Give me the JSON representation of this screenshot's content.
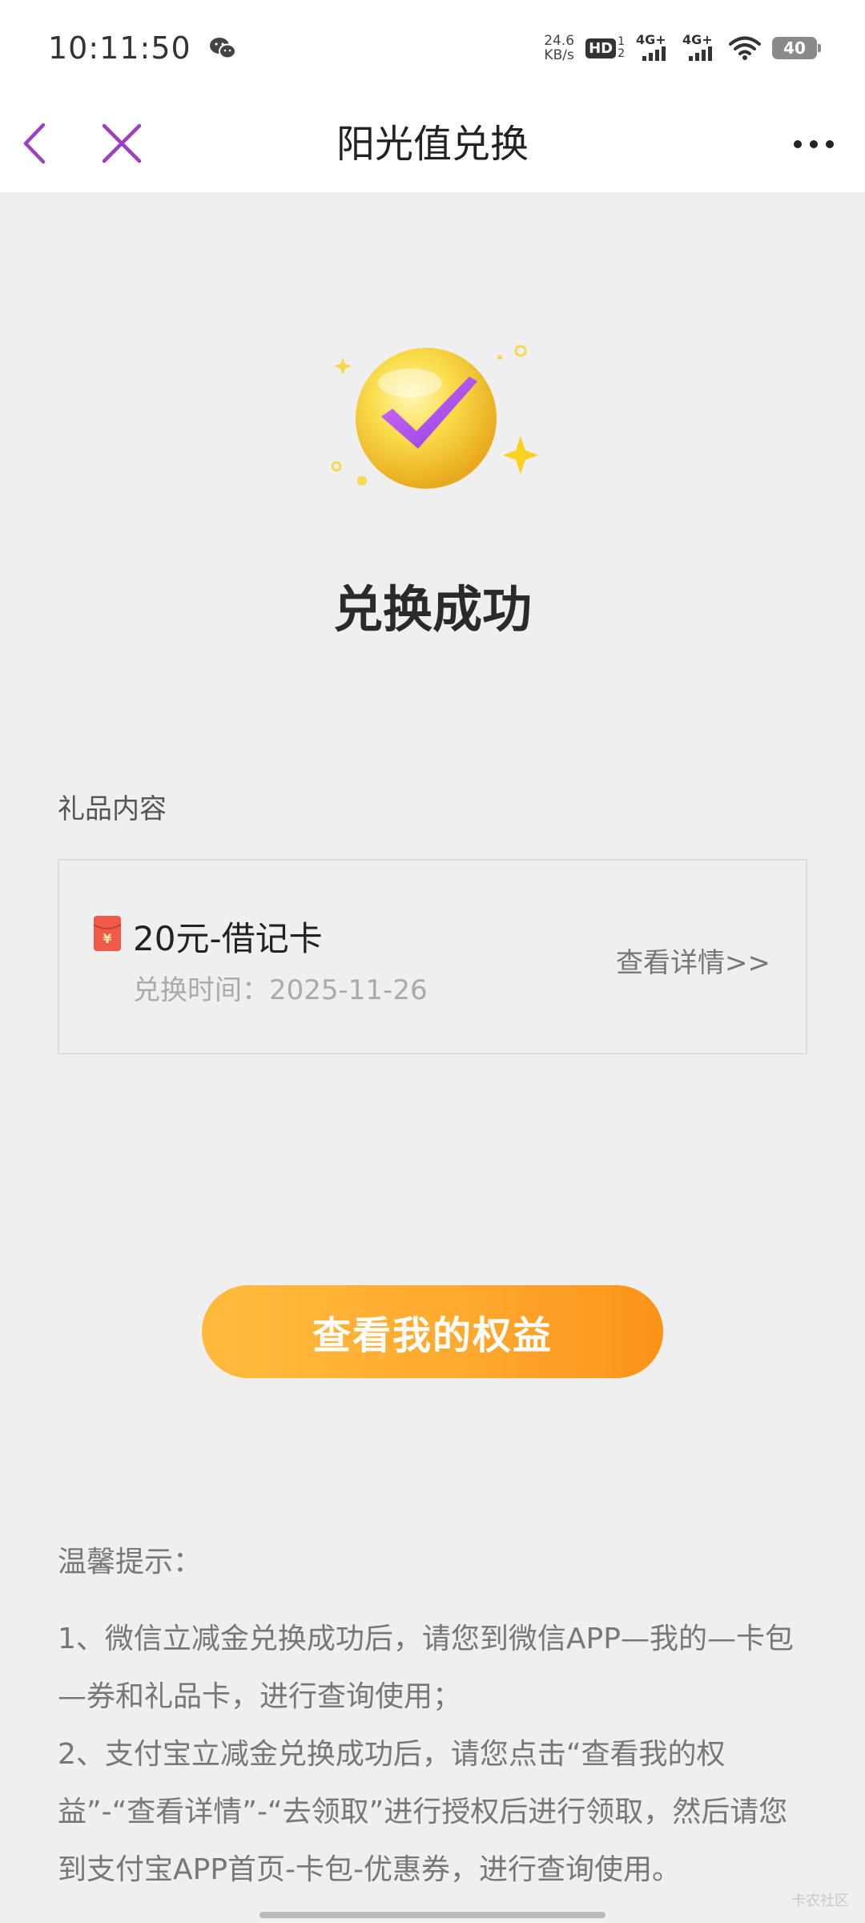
{
  "status_bar": {
    "time": "10:11:50",
    "net_speed_value": "24.6",
    "net_speed_unit": "KB/s",
    "hd_label": "HD",
    "hd_sub_top": "1",
    "hd_sub_bottom": "2",
    "sim1_label": "4G+",
    "sim2_label": "4G+",
    "battery": "40"
  },
  "nav": {
    "title": "阳光值兑换"
  },
  "success": {
    "title": "兑换成功"
  },
  "gift": {
    "section_label": "礼品内容",
    "name": "20元-借记卡",
    "time": "兑换时间：2025-11-26",
    "detail_link": "查看详情>>",
    "icon_symbol": "¥"
  },
  "primary_button": {
    "label": "查看我的权益"
  },
  "tips": {
    "title": "温馨提示：",
    "line1": "1、微信立减金兑换成功后，请您到微信APP—我的—卡包—券和礼品卡，进行查询使用；",
    "line2": "2、支付宝立减金兑换成功后，请您点击“查看我的权益”-“查看详情”-“去领取”进行授权后进行领取，然后请您到支付宝APP首页-卡包-优惠券，进行查询使用。"
  },
  "watermark": "卡农社区",
  "colors": {
    "accent_purple": "#9c3fc0",
    "button_orange_start": "#ffbb3d",
    "button_orange_end": "#fc9319",
    "badge_gold": "#f7d23a"
  },
  "icons": {
    "back": "chevron-left-icon",
    "close": "close-icon",
    "more": "more-dots-icon",
    "wechat": "wechat-icon",
    "gift": "red-envelope-icon",
    "hero": "checkmark-badge-icon"
  }
}
